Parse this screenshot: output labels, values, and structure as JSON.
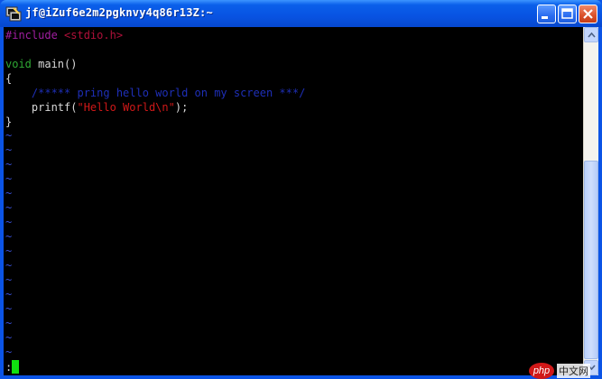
{
  "window": {
    "title": "jf@iZuf6e2m2pgknvy4q86r13Z:~",
    "icon": "putty-terminal-icon"
  },
  "controls": {
    "minimize_icon": "minimize-icon",
    "maximize_icon": "maximize-icon",
    "close_icon": "close-icon"
  },
  "editor": {
    "line1": {
      "directive": "#include",
      "header": "<stdio.h>"
    },
    "line3": {
      "keyword": "void",
      "rest": " main()"
    },
    "line4": {
      "text": "{"
    },
    "line5": {
      "text": "    /***** pring hello world on my screen ***/"
    },
    "line6": {
      "func": "    printf(",
      "string": "\"Hello World\\n\"",
      "tail": ");"
    },
    "line7": {
      "text": "}"
    },
    "tilde": "~",
    "command_prompt": ":"
  },
  "colors": {
    "preprocessor": "#a01ea0",
    "type_keyword": "#2fa834",
    "comment": "#1e2fb8",
    "string": "#d01818",
    "empty_line_marker": "#3850d8",
    "cursor": "#10e010",
    "titlebar": "#0853e2"
  },
  "watermark": {
    "logo": "php",
    "text": "中文网"
  }
}
